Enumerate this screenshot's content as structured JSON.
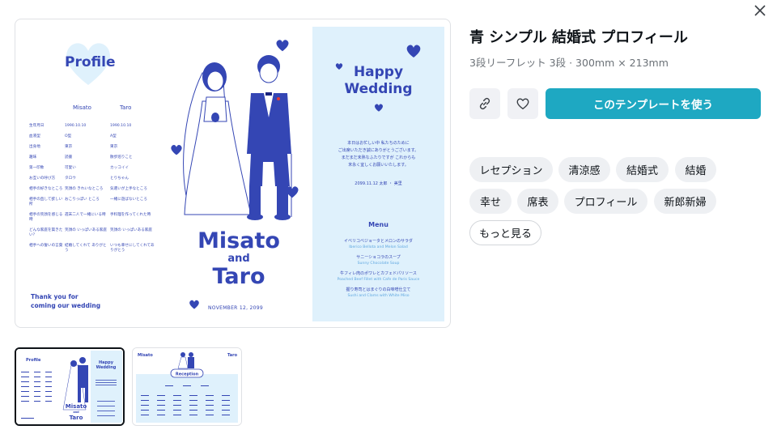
{
  "close": {
    "label": "Close"
  },
  "product": {
    "title": "青 シンプル 結婚式 プロフィール",
    "subtitle": "3段リーフレット 3段 · 300mm × 213mm",
    "use_template_label": "このテンプレートを使う",
    "tags": [
      "レセプション",
      "清涼感",
      "結婚式",
      "結婚",
      "幸せ",
      "席表",
      "プロフィール",
      "新郎新婦"
    ],
    "more_label": "もっと見る"
  },
  "preview": {
    "profile_title": "Profile",
    "col_left": "Misato",
    "col_right": "Taro",
    "rows": [
      {
        "q": "生年月日",
        "a": "1990.10.10",
        "b": "1990.10.10"
      },
      {
        "q": "血液型",
        "a": "O型",
        "b": "A型"
      },
      {
        "q": "出身地",
        "a": "東京",
        "b": "東京"
      },
      {
        "q": "趣味",
        "a": "読書",
        "b": "散歩巡りこと"
      },
      {
        "q": "第一印象",
        "a": "可愛い",
        "b": "カッコイイ"
      },
      {
        "q": "お互いの呼び方",
        "a": "タロウ",
        "b": "とりちゃん"
      },
      {
        "q": "相手の好きなところ",
        "a": "笑顔の きれいなところ",
        "b": "気遣いが上手なところ"
      },
      {
        "q": "相手の直して欲しい所",
        "a": "おこりっぽい ところ",
        "b": "一緒に遊ばないところ"
      },
      {
        "q": "相手の笑顔を感じる時",
        "a": "週末二人で一緒にいる時",
        "b": "手料理を作ってくれた時"
      },
      {
        "q": "どんな家庭を築きたい？",
        "a": "笑顔の いっぱいある家庭",
        "b": "笑顔の いっぱいある家庭"
      },
      {
        "q": "相手への誓いの言葉",
        "a": "結婚してくれて ありがとう",
        "b": "いつも幸せにしてくれてありがとう"
      }
    ],
    "thanks": [
      "Thank you for",
      "coming our wedding"
    ],
    "name1": "Misato",
    "and": "and",
    "name2": "Taro",
    "wedding_date": "NOVEMBER 12, 2099",
    "happy": "Happy",
    "wedding": "Wedding",
    "message": [
      "本日はお忙しい中 私たちのために",
      "ご出席いただき誠にありがとうございます。",
      "まだまだ未熟なふたりですが これからも",
      "末永く宜しくお願いいたします。"
    ],
    "message_date": "2099.11.12  太郎 ・ 美里",
    "menu_title": "Menu",
    "menu": [
      {
        "jp": "イベリコベジョータとメロンのサラダ",
        "en": "Iberico Bellota and Melon Salad"
      },
      {
        "jp": "サニーショコラのスープ",
        "en": "Sunny Chocolate Soup"
      },
      {
        "jp": "牛フィレ肉のポワレとカフェドパリソース",
        "en": "Poached Beef Fillet with Cafe de Paris Sauce"
      },
      {
        "jp": "握り寿司とはまぐりの白味噌仕立て",
        "en": "Sushi and Clams with White Miso"
      }
    ]
  },
  "thumbnails": {
    "t1": {
      "profile": "Profile",
      "happy": "Happy",
      "wedding": "Wedding",
      "name1": "Misato",
      "and": "and",
      "name2": "Taro"
    },
    "t2": {
      "left": "Misato",
      "right": "Taro",
      "badge": "Reception"
    }
  },
  "colors": {
    "navy": "#3446b4",
    "light_blue": "#dff1fc",
    "accent": "#1ea8c2"
  }
}
